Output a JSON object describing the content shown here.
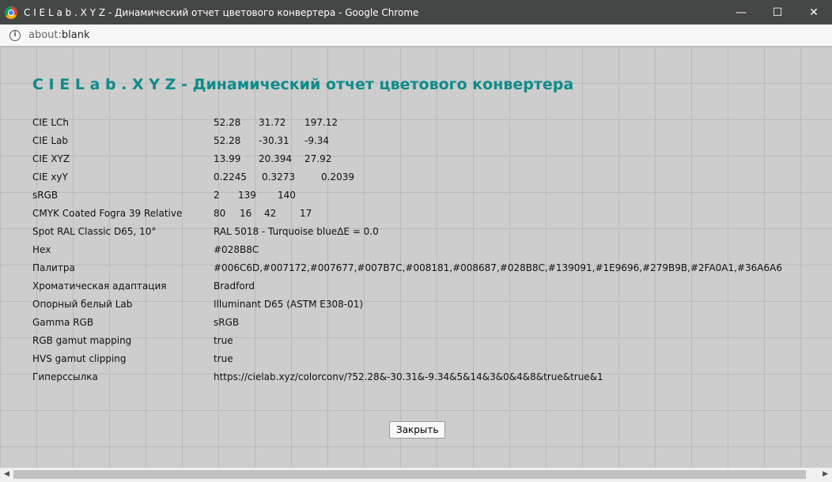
{
  "window": {
    "title": "C I E L a b . X Y Z - Динамический отчет цветового конвертера - Google Chrome",
    "minimize": "—",
    "maximize": "☐",
    "close": "✕"
  },
  "address": {
    "scheme": "about:",
    "rest": "blank"
  },
  "page": {
    "heading": "C I E L a b . X Y Z - Динамический отчет цветового конвертера",
    "rows": [
      {
        "label": "CIE LCh",
        "values": [
          "52.28",
          "31.72",
          "197.12"
        ]
      },
      {
        "label": "CIE Lab",
        "values": [
          "52.28",
          "-30.31",
          "-9.34"
        ]
      },
      {
        "label": "CIE XYZ",
        "values": [
          "13.99",
          "20.394",
          "27.92"
        ]
      },
      {
        "label": "CIE xyY",
        "values": [
          "0.2245",
          "0.3273",
          "0.2039"
        ]
      },
      {
        "label": "sRGB",
        "values": [
          "2",
          "139",
          "140"
        ]
      },
      {
        "label": "CMYK Coated Fogra 39 Relative",
        "values": [
          "80",
          "16",
          "42",
          "17"
        ]
      },
      {
        "label": "Spot RAL Classic D65, 10°",
        "values": [
          "RAL 5018 - Turquoise blue",
          "ΔE = 0.0"
        ]
      },
      {
        "label": "Hex",
        "values": [
          "#028B8C"
        ]
      },
      {
        "label": "Палитра",
        "values": [
          "#006C6D,#007172,#007677,#007B7C,#008181,#008687,#028B8C,#139091,#1E9696,#279B9B,#2FA0A1,#36A6A6"
        ]
      },
      {
        "label": "Хроматическая адаптация",
        "values": [
          "Bradford"
        ]
      },
      {
        "label": "Опорный белый Lab",
        "values": [
          "Illuminant D65 (ASTM E308-01)"
        ]
      },
      {
        "label": "Gamma RGB",
        "values": [
          "sRGB"
        ]
      },
      {
        "label": "RGB gamut mapping",
        "values": [
          "true"
        ]
      },
      {
        "label": "HVS gamut clipping",
        "values": [
          "true"
        ]
      },
      {
        "label": "Гиперссылка",
        "values": [
          "https://cielab.xyz/colorconv/?52.28&-30.31&-9.34&5&14&3&0&4&8&true&true&1"
        ]
      }
    ],
    "close_label": "Закрыть"
  },
  "colors": {
    "heading": "#0e8b8b",
    "background": "#cccdcc"
  }
}
